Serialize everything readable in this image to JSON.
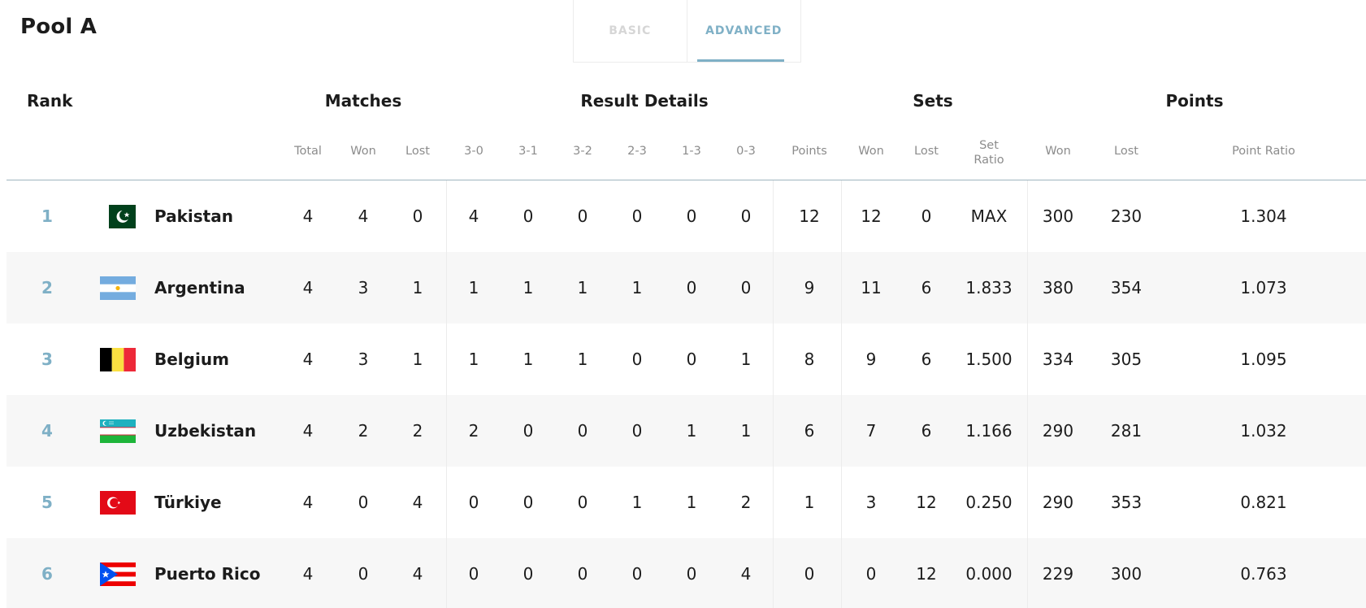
{
  "page_title": "Pool A",
  "tabs": {
    "basic": "BASIC",
    "advanced": "ADVANCED",
    "active": "advanced"
  },
  "headers": {
    "rank": "Rank",
    "matches": "Matches",
    "result_details": "Result Details",
    "sets": "Sets",
    "points": "Points"
  },
  "subheaders": {
    "total": "Total",
    "won": "Won",
    "lost": "Lost",
    "r30": "3-0",
    "r31": "3-1",
    "r32": "3-2",
    "r23": "2-3",
    "r13": "1-3",
    "r03": "0-3",
    "points": "Points",
    "sets_won": "Won",
    "sets_lost": "Lost",
    "set_ratio_1": "Set",
    "set_ratio_2": "Ratio",
    "points_won": "Won",
    "points_lost": "Lost",
    "point_ratio": "Point Ratio"
  },
  "rows": [
    {
      "rank": "1",
      "country": "Pakistan",
      "flag": "pakistan-flag-icon",
      "total": "4",
      "won": "4",
      "lost": "0",
      "r30": "4",
      "r31": "0",
      "r32": "0",
      "r23": "0",
      "r13": "0",
      "r03": "0",
      "points": "12",
      "sets_won": "12",
      "sets_lost": "0",
      "set_ratio": "MAX",
      "points_won": "300",
      "points_lost": "230",
      "point_ratio": "1.304"
    },
    {
      "rank": "2",
      "country": "Argentina",
      "flag": "argentina-flag-icon",
      "total": "4",
      "won": "3",
      "lost": "1",
      "r30": "1",
      "r31": "1",
      "r32": "1",
      "r23": "1",
      "r13": "0",
      "r03": "0",
      "points": "9",
      "sets_won": "11",
      "sets_lost": "6",
      "set_ratio": "1.833",
      "points_won": "380",
      "points_lost": "354",
      "point_ratio": "1.073"
    },
    {
      "rank": "3",
      "country": "Belgium",
      "flag": "belgium-flag-icon",
      "total": "4",
      "won": "3",
      "lost": "1",
      "r30": "1",
      "r31": "1",
      "r32": "1",
      "r23": "0",
      "r13": "0",
      "r03": "1",
      "points": "8",
      "sets_won": "9",
      "sets_lost": "6",
      "set_ratio": "1.500",
      "points_won": "334",
      "points_lost": "305",
      "point_ratio": "1.095"
    },
    {
      "rank": "4",
      "country": "Uzbekistan",
      "flag": "uzbekistan-flag-icon",
      "total": "4",
      "won": "2",
      "lost": "2",
      "r30": "2",
      "r31": "0",
      "r32": "0",
      "r23": "0",
      "r13": "1",
      "r03": "1",
      "points": "6",
      "sets_won": "7",
      "sets_lost": "6",
      "set_ratio": "1.166",
      "points_won": "290",
      "points_lost": "281",
      "point_ratio": "1.032"
    },
    {
      "rank": "5",
      "country": "Türkiye",
      "flag": "turkiye-flag-icon",
      "total": "4",
      "won": "0",
      "lost": "4",
      "r30": "0",
      "r31": "0",
      "r32": "0",
      "r23": "1",
      "r13": "1",
      "r03": "2",
      "points": "1",
      "sets_won": "3",
      "sets_lost": "12",
      "set_ratio": "0.250",
      "points_won": "290",
      "points_lost": "353",
      "point_ratio": "0.821"
    },
    {
      "rank": "6",
      "country": "Puerto Rico",
      "flag": "puerto-rico-flag-icon",
      "total": "4",
      "won": "0",
      "lost": "4",
      "r30": "0",
      "r31": "0",
      "r32": "0",
      "r23": "0",
      "r13": "0",
      "r03": "4",
      "points": "0",
      "sets_won": "0",
      "sets_lost": "12",
      "set_ratio": "0.000",
      "points_won": "229",
      "points_lost": "300",
      "point_ratio": "0.763"
    }
  ],
  "colors": {
    "accent": "#7fb0c6",
    "muted": "#8c8c8c",
    "row_alt": "#f7f7f7"
  }
}
